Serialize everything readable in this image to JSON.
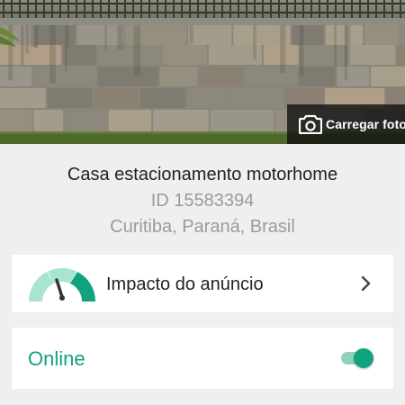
{
  "cover": {
    "image": "stone-wall-with-iron-fence",
    "upload_button": {
      "label": "Carregar foto",
      "icon": "camera-icon"
    }
  },
  "listing": {
    "title": "Casa estacionamento motorhome",
    "id_text": "ID 15583394",
    "location": "Curitiba, Paraná, Brasil"
  },
  "impact": {
    "label": "Impacto do anúncio",
    "icon": "gauge-icon",
    "action_icon": "chevron-right-icon"
  },
  "status": {
    "label": "Online",
    "toggle_on": true
  },
  "colors": {
    "accent": "#11a37f",
    "accent_light": "#8fd2bd",
    "gauge_light": "#a9e4cf",
    "background": "#efefef",
    "card": "#ffffff",
    "primary_text": "#222222",
    "secondary_text": "#9b9b9b"
  }
}
